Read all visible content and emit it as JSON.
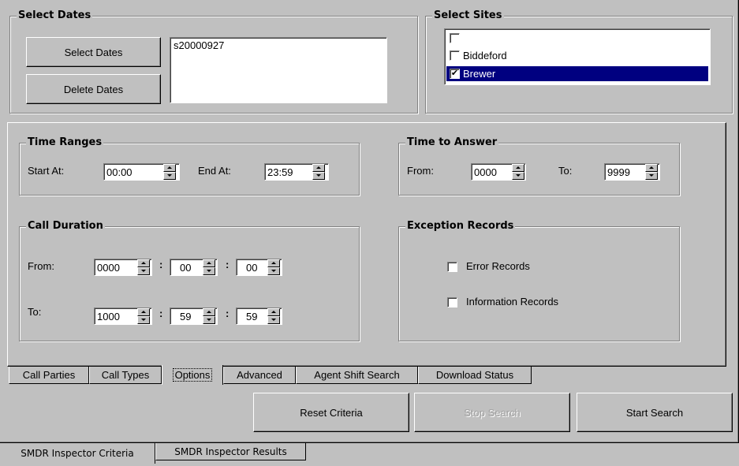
{
  "select_dates": {
    "legend": "Select Dates",
    "select_button": "Select Dates",
    "delete_button": "Delete Dates",
    "dates_list": [
      "s20000927"
    ]
  },
  "select_sites": {
    "legend": "Select Sites",
    "items": [
      {
        "label": "",
        "checked": false,
        "selected": false
      },
      {
        "label": "Biddeford",
        "checked": false,
        "selected": false
      },
      {
        "label": "Brewer",
        "checked": true,
        "selected": true
      }
    ]
  },
  "time_ranges": {
    "legend": "Time Ranges",
    "start_label": "Start At:",
    "start_value": "00:00",
    "end_label": "End At:",
    "end_value": "23:59"
  },
  "time_to_answer": {
    "legend": "Time to Answer",
    "from_label": "From:",
    "from_value": "0000",
    "to_label": "To:",
    "to_value": "9999"
  },
  "call_duration": {
    "legend": "Call Duration",
    "from_label": "From:",
    "from": [
      "0000",
      "00",
      "00"
    ],
    "to_label": "To:",
    "to": [
      "1000",
      "59",
      "59"
    ],
    "separator": ":"
  },
  "exception_records": {
    "legend": "Exception Records",
    "error_label": "Error Records",
    "error_checked": false,
    "info_label": "Information Records",
    "info_checked": false
  },
  "criteria_tabs": [
    "Call Parties",
    "Call Types",
    "Options",
    "Advanced",
    "Agent Shift Search",
    "Download Status"
  ],
  "active_criteria_tab": "Options",
  "actions": {
    "reset": "Reset Criteria",
    "stop": "Stop Search",
    "start": "Start Search"
  },
  "bottom_tabs": [
    "SMDR Inspector Criteria",
    "SMDR Inspector Results"
  ],
  "active_bottom_tab": "SMDR Inspector Criteria",
  "check_glyph": "✔"
}
